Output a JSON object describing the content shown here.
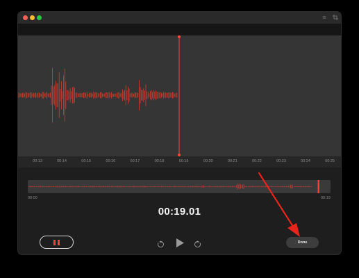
{
  "window": {
    "traffic_lights": [
      {
        "name": "close",
        "color": "#ff5f57"
      },
      {
        "name": "minimize",
        "color": "#febc2e"
      },
      {
        "name": "zoom",
        "color": "#28c840"
      }
    ],
    "toolbar_icons": [
      "list-icon",
      "trim-icon"
    ]
  },
  "colors": {
    "accent_red": "#ff453a",
    "wave_red": "#d9382e",
    "background": "#1e1e1e",
    "annotation_arrow": "#e8251c"
  },
  "timeline": {
    "tick_labels": [
      "00:13",
      "00:14",
      "00:15",
      "00:16",
      "00:17",
      "00:18",
      "00:19",
      "00:20",
      "00:21",
      "00:22",
      "00:23",
      "00:24",
      "00:25"
    ],
    "playhead_time": "00:19"
  },
  "overview": {
    "start_label": "00:00",
    "end_label": "00:19",
    "playhead_position": 0.96
  },
  "timer": {
    "current_time": "00:19.01"
  },
  "controls": {
    "skip_back_label": "15",
    "skip_forward_label": "15",
    "done_label": "Done"
  }
}
